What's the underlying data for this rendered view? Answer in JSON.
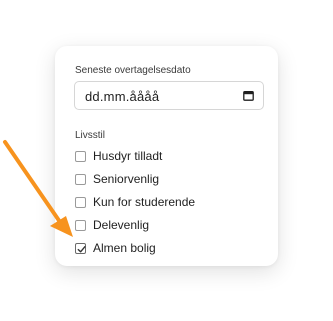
{
  "filter_panel": {
    "date_label": "Seneste overtagelsesdato",
    "date_value": "dd.mm.åååå",
    "lifestyle_label": "Livsstil",
    "options": [
      {
        "label": "Husdyr tilladt",
        "checked": false
      },
      {
        "label": "Seniorvenlig",
        "checked": false
      },
      {
        "label": "Kun for studerende",
        "checked": false
      },
      {
        "label": "Delevenlig",
        "checked": false
      },
      {
        "label": "Almen bolig",
        "checked": true
      }
    ]
  },
  "annotation": {
    "arrow_color": "#F7931E"
  }
}
